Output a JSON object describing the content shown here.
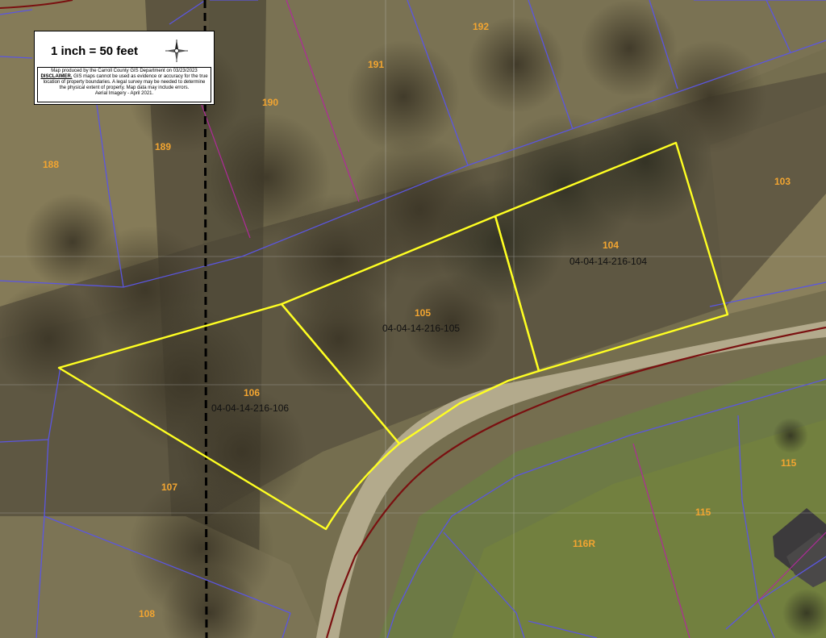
{
  "legend": {
    "scale": "1 inch = 50 feet",
    "produced_by": "Map produced by the Carroll County GIS Department on 03/23/2023",
    "disclaimer_label": "DISCLAIMER.",
    "disclaimer_text": "GIS maps cannot be used as evidence or accuracy for the true location of property boundaries. A legal survey may be needed to determine the physical extent of property. Map data may include errors.",
    "imagery": "Aerial Imagery - April 2021."
  },
  "compass_icon": "compass-rose-icon",
  "colors": {
    "parcel_line": "#5b56e0",
    "selected_parcel": "#ffff22",
    "lot_label": "#f2a531",
    "road_centerline": "#7a1010",
    "township_line": "#000000",
    "easement_line": "#b02a9a"
  },
  "lots": {
    "l192": "192",
    "l191": "191",
    "l190": "190",
    "l189": "189",
    "l188": "188",
    "l103": "103",
    "l104": "104",
    "l105": "105",
    "l106": "106",
    "l107": "107",
    "l108": "108",
    "l115a": "115",
    "l115b": "115",
    "l116r": "116R"
  },
  "parcels": {
    "p104": "04-04-14-216-104",
    "p105": "04-04-14-216-105",
    "p106": "04-04-14-216-106"
  }
}
